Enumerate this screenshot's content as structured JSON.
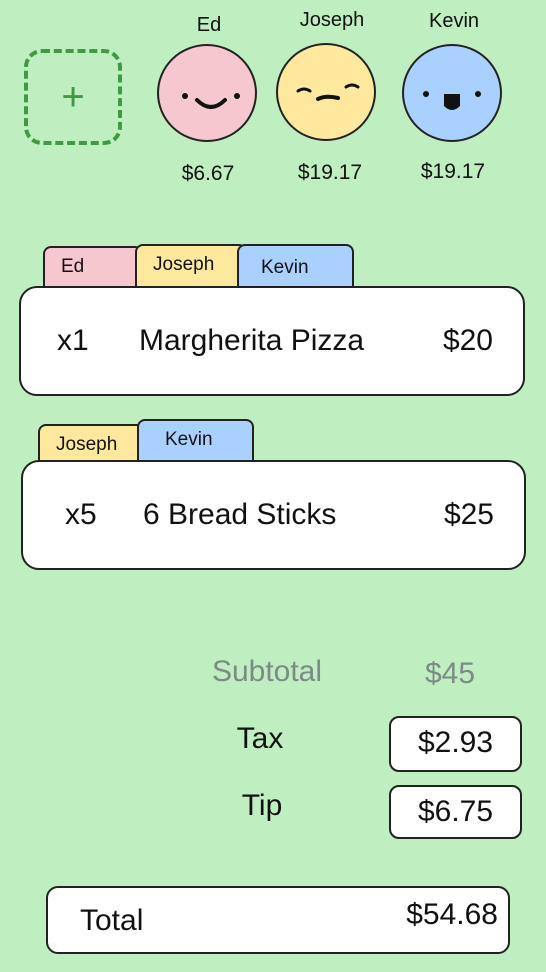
{
  "add_button": {
    "icon": "plus-icon",
    "label": "+"
  },
  "people": [
    {
      "name": "Ed",
      "amount": "$6.67",
      "color": "#f6c7cf"
    },
    {
      "name": "Joseph",
      "amount": "$19.17",
      "color": "#fde89e"
    },
    {
      "name": "Kevin",
      "amount": "$19.17",
      "color": "#a9d0ff"
    }
  ],
  "items": [
    {
      "tabs": [
        "Ed",
        "Joseph",
        "Kevin"
      ],
      "qty": "x1",
      "name": "Margherita Pizza",
      "price": "$20"
    },
    {
      "tabs": [
        "Joseph",
        "Kevin"
      ],
      "qty": "x5",
      "name": "6 Bread Sticks",
      "price": "$25"
    }
  ],
  "summary": {
    "subtotal_label": "Subtotal",
    "subtotal_value": "$45",
    "tax_label": "Tax",
    "tax_value": "$2.93",
    "tip_label": "Tip",
    "tip_value": "$6.75"
  },
  "total": {
    "label": "Total",
    "value": "$54.68"
  },
  "colors": {
    "background": "#bfeec0",
    "accent_green": "#3f9a43",
    "muted": "#7d8a86"
  }
}
